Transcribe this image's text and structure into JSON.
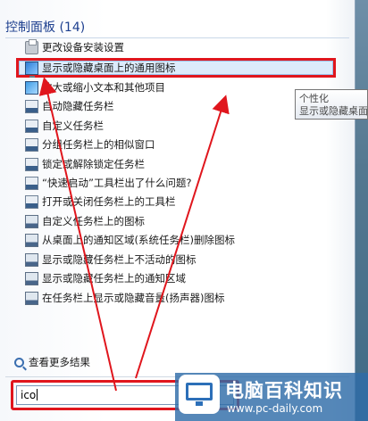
{
  "header": {
    "title": "控制面板 (14)"
  },
  "results": [
    {
      "label": "更改设备安装设置",
      "icon": "printer-icon"
    },
    {
      "label": "显示或隐藏桌面上的通用图标",
      "icon": "monitor-icon"
    },
    {
      "label": "放大或缩小文本和其他项目",
      "icon": "display-icon"
    },
    {
      "label": "自动隐藏任务栏",
      "icon": "taskbar-icon"
    },
    {
      "label": "自定义任务栏",
      "icon": "taskbar-icon"
    },
    {
      "label": "分组任务栏上的相似窗口",
      "icon": "taskbar-icon"
    },
    {
      "label": "锁定或解除锁定任务栏",
      "icon": "taskbar-icon"
    },
    {
      "label": "“快速启动”工具栏出了什么问题?",
      "icon": "taskbar-icon"
    },
    {
      "label": "打开或关闭任务栏上的工具栏",
      "icon": "taskbar-icon"
    },
    {
      "label": "自定义任务栏上的图标",
      "icon": "screen-icon"
    },
    {
      "label": "从桌面上的通知区域(系统任务栏)删除图标",
      "icon": "screen-icon"
    },
    {
      "label": "显示或隐藏任务栏上不活动的图标",
      "icon": "screen-icon"
    },
    {
      "label": "显示或隐藏任务栏上的通知区域",
      "icon": "screen-icon"
    },
    {
      "label": "在任务栏上显示或隐藏音量(扬声器)图标",
      "icon": "screen-icon"
    }
  ],
  "tooltip": {
    "line1": "个性化",
    "line2": "显示或隐藏桌面"
  },
  "more_results": {
    "label": "查看更多结果"
  },
  "search": {
    "value": "ico"
  },
  "watermark": {
    "title": "电脑百科知识",
    "url": "www.pc-daily.com"
  },
  "colors": {
    "annotation_red": "#e0161d",
    "header_blue": "#1d3f8f"
  }
}
